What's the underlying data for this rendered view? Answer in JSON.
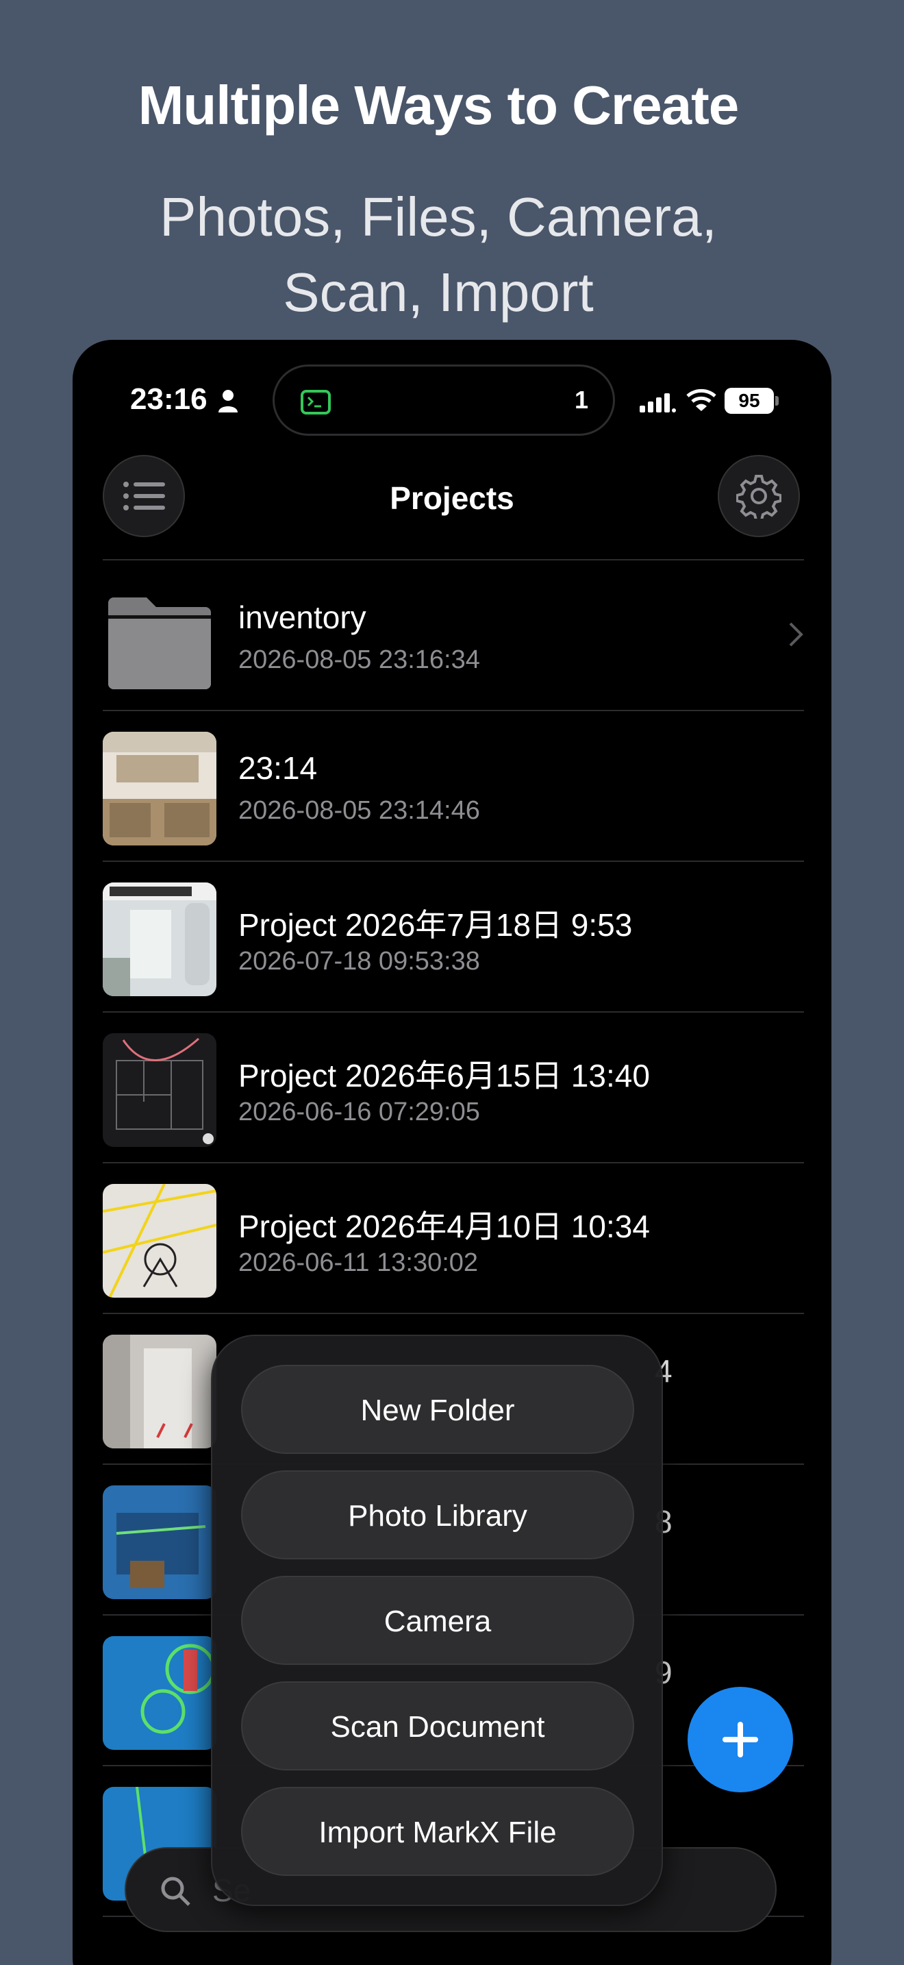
{
  "promo": {
    "headline": "Multiple Ways to Create",
    "subhead_line1": "Photos, Files, Camera,",
    "subhead_line2": "Scan, Import"
  },
  "status_bar": {
    "time": "23:16",
    "island_count": "1",
    "battery": "95"
  },
  "nav": {
    "title": "Projects",
    "menu_icon": "list-icon",
    "settings_icon": "gear-icon"
  },
  "projects": [
    {
      "title": "inventory",
      "date": "2026-08-05 23:16:34",
      "kind": "folder"
    },
    {
      "title": "23:14",
      "date": "2026-08-05 23:14:46",
      "kind": "photo"
    },
    {
      "title": "Project 2026年7月18日 9:53",
      "date": "2026-07-18 09:53:38",
      "kind": "photo"
    },
    {
      "title": "Project 2026年6月15日 13:40",
      "date": "2026-06-16 07:29:05",
      "kind": "photo"
    },
    {
      "title": "Project 2026年4月10日 10:34",
      "date": "2026-06-11 13:30:02",
      "kind": "photo"
    },
    {
      "title": "4",
      "date": "",
      "kind": "photo"
    },
    {
      "title": "8",
      "date": "",
      "kind": "photo"
    },
    {
      "title": "9",
      "date": "",
      "kind": "photo"
    },
    {
      "title": "",
      "date": "",
      "kind": "photo"
    }
  ],
  "add_menu": {
    "items": [
      "New Folder",
      "Photo Library",
      "Camera",
      "Scan Document",
      "Import MarkX File"
    ]
  },
  "search": {
    "placeholder": "Se"
  },
  "colors": {
    "background": "#4a5669",
    "accent": "#1a86f0"
  }
}
